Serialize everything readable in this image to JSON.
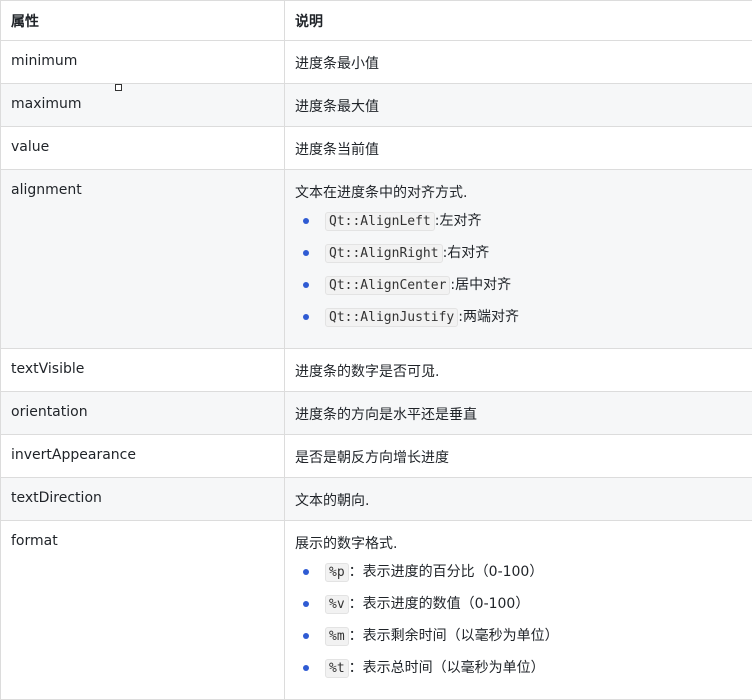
{
  "headers": {
    "property": "属性",
    "description": "说明"
  },
  "rows": [
    {
      "property": "minimum",
      "description": "进度条最小值"
    },
    {
      "property": "maximum",
      "description": "进度条最大值"
    },
    {
      "property": "value",
      "description": "进度条当前值"
    },
    {
      "property": "alignment",
      "description": "文本在进度条中的对齐方式.",
      "items": [
        {
          "code": "Qt::AlignLeft",
          "text": ":左对齐"
        },
        {
          "code": "Qt::AlignRight",
          "text": ":右对齐"
        },
        {
          "code": "Qt::AlignCenter",
          "text": ":居中对齐"
        },
        {
          "code": "Qt::AlignJustify",
          "text": ":两端对齐"
        }
      ]
    },
    {
      "property": "textVisible",
      "description": "进度条的数字是否可见."
    },
    {
      "property": "orientation",
      "description": "进度条的方向是水平还是垂直"
    },
    {
      "property": "invertAppearance",
      "description": "是否是朝反方向增长进度"
    },
    {
      "property": "textDirection",
      "description": "文本的朝向."
    },
    {
      "property": "format",
      "description": "展示的数字格式.",
      "items": [
        {
          "code": "%p",
          "text": "：表示进度的百分比（0-100）"
        },
        {
          "code": "%v",
          "text": "：表示进度的数值（0-100）"
        },
        {
          "code": "%m",
          "text": "：表示剩余时间（以毫秒为单位）"
        },
        {
          "code": "%t",
          "text": "：表示总时间（以毫秒为单位）"
        }
      ]
    }
  ],
  "icons": {
    "cursor": "text-cursor-icon",
    "box": "selection-handle-icon"
  },
  "colors": {
    "bullet": "#2f5bd3",
    "border": "#dcdcdc",
    "stripe": "#f6f7f8"
  }
}
